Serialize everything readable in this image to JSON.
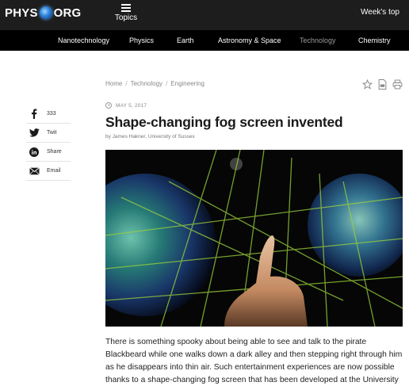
{
  "header": {
    "logo_left": "PHYS",
    "logo_right": "ORG",
    "topics_label": "Topics",
    "weeks_top": "Week's top"
  },
  "categories": [
    {
      "label": "Nanotechnology",
      "active": true
    },
    {
      "label": "Physics",
      "active": true
    },
    {
      "label": "Earth",
      "active": true
    },
    {
      "label": "Astronomy & Space",
      "active": true
    },
    {
      "label": "Technology",
      "active": false
    },
    {
      "label": "Chemistry",
      "active": true
    }
  ],
  "breadcrumb": [
    "Home",
    "Technology",
    "Engineering"
  ],
  "tools": [
    "star-icon",
    "pdf-icon",
    "print-icon"
  ],
  "share": [
    {
      "icon": "facebook-icon",
      "label": "333"
    },
    {
      "icon": "twitter-icon",
      "label": "Twit"
    },
    {
      "icon": "linkedin-icon",
      "label": "Share"
    },
    {
      "icon": "email-icon",
      "label": "Email"
    }
  ],
  "article": {
    "date": "MAY 5, 2017",
    "title": "Shape-changing fog screen invented",
    "byline": "by James Hakner, University of Sussex",
    "paragraph": "There is something spooky about being able to see and talk to the pirate Blackbeard while one walks down a dark alley and then stepping right through him as he disappears into thin air. Such entertainment experiences are now possible thanks to a shape-changing fog screen that has been developed at the University of Sussex."
  },
  "colors": {
    "topbar": "#1d1d1d",
    "catnav": "#000000",
    "grid": "#9bd23a"
  }
}
